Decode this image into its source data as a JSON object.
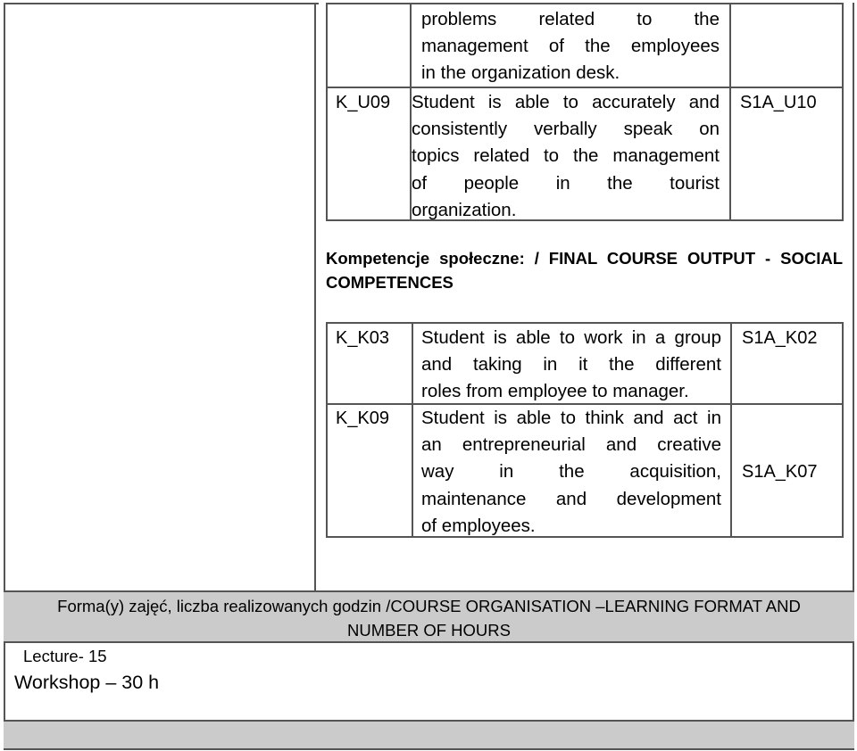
{
  "skills_table": {
    "rows": [
      {
        "code": "",
        "lines": [
          "problems related to the",
          "management of the employees",
          "in the organization desk."
        ],
        "ref": ""
      },
      {
        "code": "K_U09",
        "lines": [
          "Student is able to accurately and",
          "consistently verbally speak on",
          "topics related to the management",
          "of people in the tourist",
          "organization."
        ],
        "ref": "S1A_U10"
      }
    ]
  },
  "social_heading": {
    "line1": "Kompetencje społeczne: / FINAL COURSE OUTPUT - SOCIAL",
    "line2": "COMPETENCES"
  },
  "social_table": {
    "rows": [
      {
        "code": "K_K03",
        "lines": [
          "Student is able to work in a group",
          "and  taking in it the different",
          "roles from employee to manager."
        ],
        "ref": "S1A_K02"
      },
      {
        "code": "K_K09",
        "lines": [
          "Student is able to think and act in",
          "an entrepreneurial and creative",
          "way in the acquisition,",
          "maintenance and development",
          "of employees."
        ],
        "ref": "S1A_K07"
      }
    ]
  },
  "course_organisation": {
    "header_line1": "Forma(y) zajęć, liczba realizowanych godzin /COURSE ORGANISATION –LEARNING FORMAT AND",
    "header_line2": "NUMBER OF  HOURS",
    "items": [
      "Lecture- 15",
      "Workshop – 30 h"
    ]
  },
  "colors": {
    "band_gray": "#cbcbcb",
    "border": "#555555"
  }
}
